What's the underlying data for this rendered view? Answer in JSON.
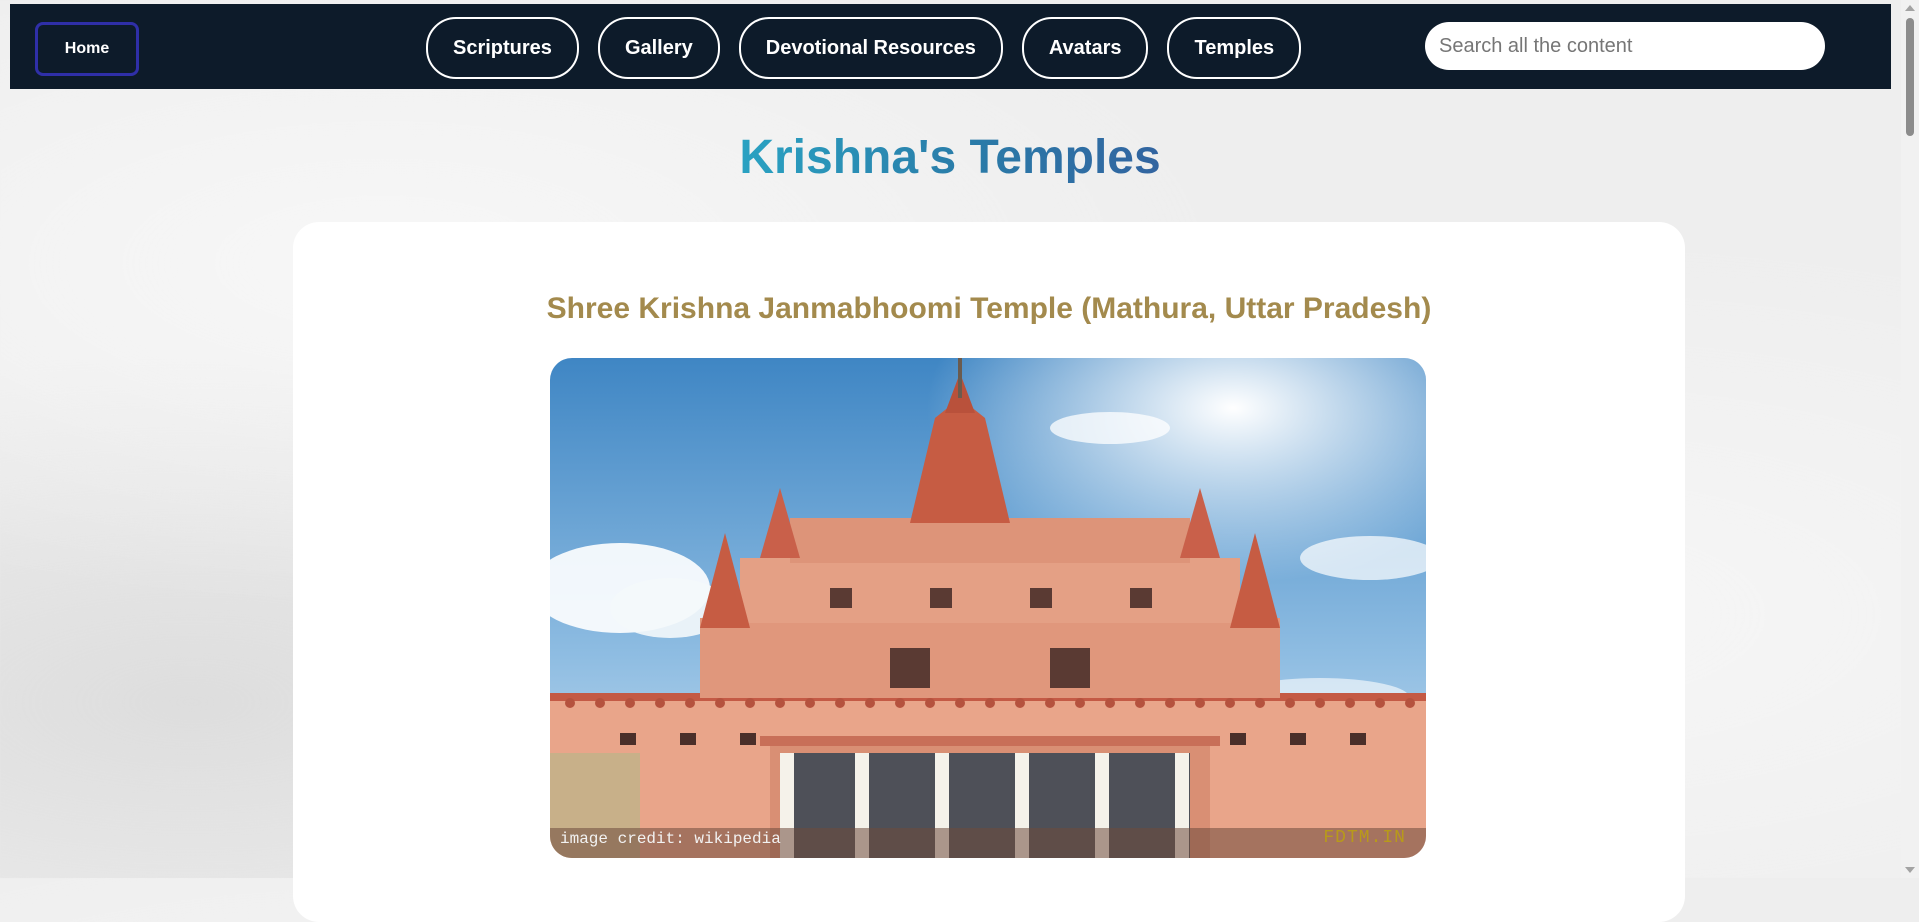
{
  "nav": {
    "home_label": "Home",
    "links": [
      {
        "label": "Scriptures"
      },
      {
        "label": "Gallery"
      },
      {
        "label": "Devotional Resources"
      },
      {
        "label": "Avatars"
      },
      {
        "label": "Temples"
      }
    ],
    "search_placeholder": "Search all the content"
  },
  "page": {
    "title": "Krishna's Temples"
  },
  "temple": {
    "title": "Shree Krishna Janmabhoomi Temple (Mathura, Uttar Pradesh)",
    "image_credit": "image credit: wikipedia",
    "watermark": "FDTM.IN"
  },
  "colors": {
    "navbar": "#0d1b2a",
    "home_border": "#2f2fa8",
    "title_gradient_start": "#2aa2c2",
    "title_gradient_end": "#3264a0",
    "temple_title": "#a38a4d"
  }
}
